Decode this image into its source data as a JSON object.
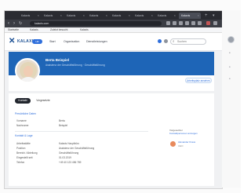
{
  "browser": {
    "tabs": [
      {
        "label": "Kalaxis"
      },
      {
        "label": "Kalaxis"
      },
      {
        "label": "Kalaxis"
      },
      {
        "label": "Kalaxis"
      },
      {
        "label": "Kalaxis"
      },
      {
        "label": "Kalaxis"
      },
      {
        "label": "Kalaxis"
      },
      {
        "label": "Kalaxis"
      }
    ],
    "address": "kalaxis.com",
    "bookmarks": [
      "Startseite",
      "Kalaxis",
      "Zuletzt besucht",
      "Kalaxis"
    ]
  },
  "app": {
    "logo_text": "KALAXIS",
    "logo_badge": "HR",
    "nav": [
      "Start",
      "Organisation",
      "Dienstleistungen"
    ],
    "search_placeholder": "Suchen"
  },
  "profile": {
    "name": "Berta Beispiel",
    "role": "Assistenz der Geschäftsführung · Geschäftsführung",
    "action_button": "Arbeitsplatz ansehen"
  },
  "tabs": [
    {
      "label": "Kontakt"
    },
    {
      "label": "Vorgesetzte"
    }
  ],
  "sections": [
    {
      "title": "Persönliche Daten",
      "fields": [
        {
          "label": "Vorname",
          "value": "Berta"
        },
        {
          "label": "Nachname",
          "value": "Beispiel"
        }
      ]
    },
    {
      "title": "Kontakt & Lage",
      "fields": [
        {
          "label": "Arbeitsstätte",
          "value": "Kalaxis Hauptbüro"
        },
        {
          "label": "Position",
          "value": "Assistenz der Geschäftsführung"
        },
        {
          "label": "Bereich / Abteilung",
          "value": "Geschäftsführung"
        },
        {
          "label": "Eingestellt seit",
          "value": "01.03.2019"
        },
        {
          "label": "Telefon",
          "value": "+49 40 123 456 789"
        }
      ]
    }
  ],
  "sidebar": {
    "label": "Vorgesetzter",
    "link": "Kontaktpersonen anzeigen",
    "manager_name": "Alexander Kraus",
    "manager_role": "CEO"
  }
}
